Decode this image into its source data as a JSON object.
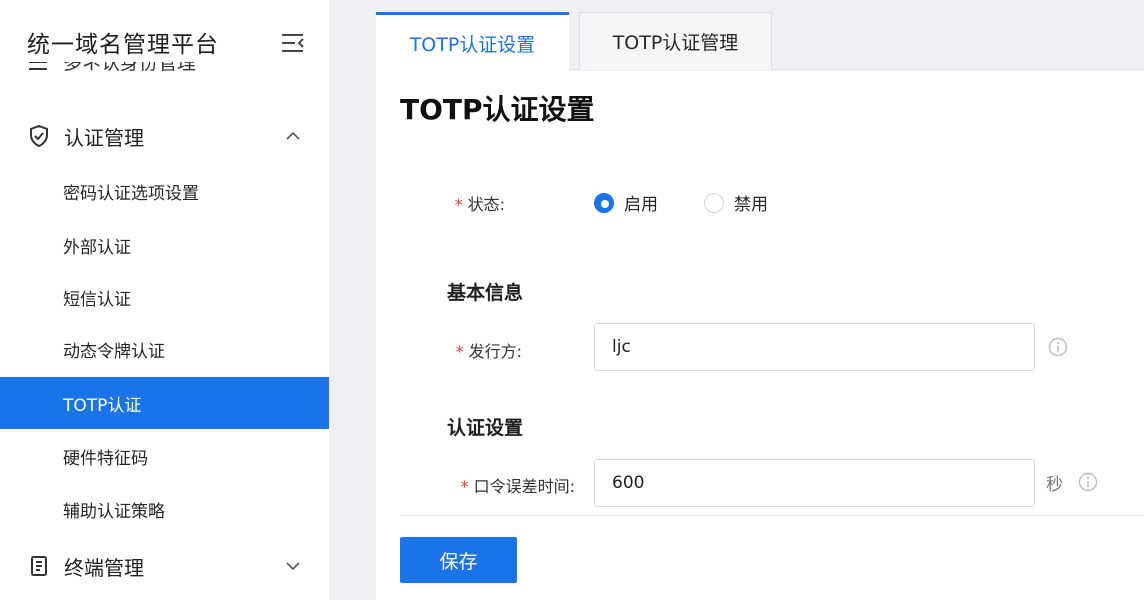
{
  "sidebar": {
    "brand": "统一域名管理平台",
    "cut_item_label": "多ネ认身份管理",
    "auth_group": {
      "label": "认证管理"
    },
    "auth_items": [
      {
        "label": "密码认证选项设置"
      },
      {
        "label": "外部认证"
      },
      {
        "label": "短信认证"
      },
      {
        "label": "动态令牌认证"
      },
      {
        "label": "TOTP认证"
      },
      {
        "label": "硬件特征码"
      },
      {
        "label": "辅助认证策略"
      }
    ],
    "active_item": "TOTP认证",
    "terminal_group": {
      "label": "终端管理"
    }
  },
  "tabs": [
    {
      "label": "TOTP认证设置",
      "active": true
    },
    {
      "label": "TOTP认证管理",
      "active": false
    }
  ],
  "page_title": "TOTP认证设置",
  "form": {
    "status": {
      "required_mark": "*",
      "label": "状态:",
      "options": [
        {
          "label": "启用",
          "checked": true
        },
        {
          "label": "禁用",
          "checked": false
        }
      ]
    },
    "basic_info_title": "基本信息",
    "issuer": {
      "required_mark": "*",
      "label": "发行方:",
      "value": "ljc"
    },
    "auth_settings_title": "认证设置",
    "tolerance": {
      "required_mark": "*",
      "label": "口令误差时间:",
      "value": "600",
      "unit": "秒"
    }
  },
  "save_label": "保存",
  "colors": {
    "accent": "#1a73e8",
    "required": "#e53935"
  }
}
